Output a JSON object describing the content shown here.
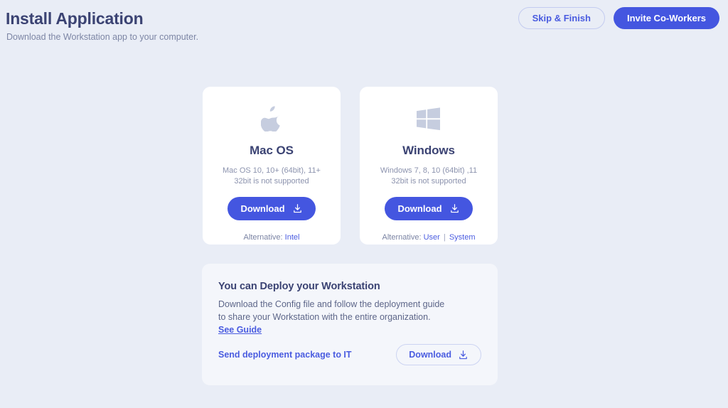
{
  "header": {
    "title": "Install Application",
    "subtitle": "Download the Workstation app to your computer.",
    "skip_label": "Skip & Finish",
    "invite_label": "Invite Co-Workers"
  },
  "colors": {
    "background": "#e9edf6",
    "card": "#ffffff",
    "panel": "#f4f6fb",
    "primary": "#4456e0",
    "link": "#4a5ce0",
    "title_text": "#3b4373",
    "muted_text": "#8c93ae",
    "logo_gray": "#c6cddf",
    "outline_border": "#c3cbf0"
  },
  "os_cards": [
    {
      "icon": "apple-logo-icon",
      "name": "Mac OS",
      "requirements_line1": "Mac OS 10, 10+ (64bit), 11+",
      "requirements_line2": "32bit is not supported",
      "download_label": "Download",
      "download_icon": "download-icon",
      "alternative_label": "Alternative:",
      "alternatives": [
        "Intel"
      ]
    },
    {
      "icon": "windows-logo-icon",
      "name": "Windows",
      "requirements_line1": "Windows 7, 8, 10 (64bit) ,11",
      "requirements_line2": "32bit is not supported",
      "download_label": "Download",
      "download_icon": "download-icon",
      "alternative_label": "Alternative:",
      "alternatives": [
        "User",
        "System"
      ],
      "alternative_separator": "|"
    }
  ],
  "deploy": {
    "title": "You can Deploy your Workstation",
    "description_line1": "Download the Config file and follow the deployment guide to",
    "description_line2": "share your Workstation with the entire organization.",
    "guide_link": "See Guide",
    "send_link": "Send deployment package to IT",
    "download_label": "Download",
    "download_icon": "download-icon"
  }
}
